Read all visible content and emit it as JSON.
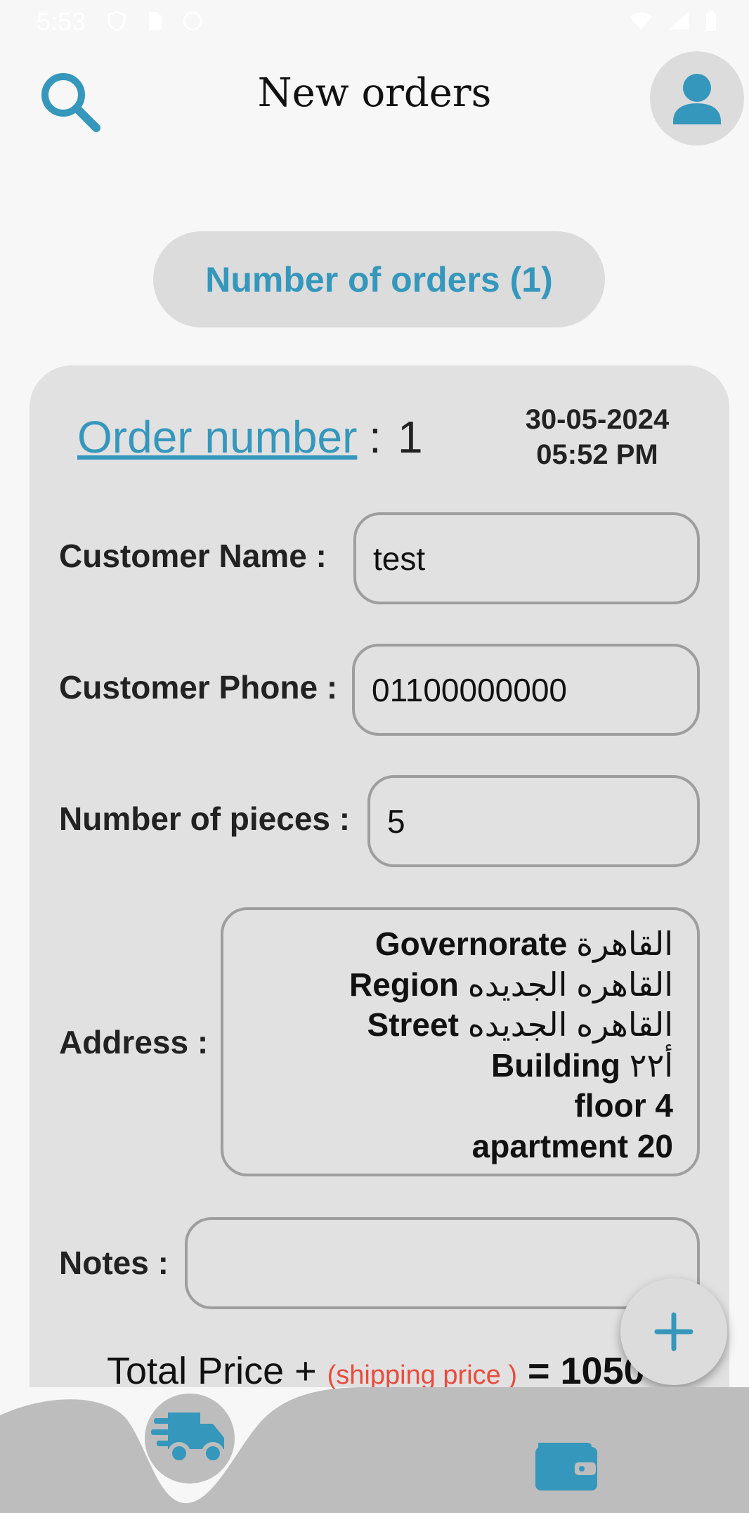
{
  "status_bar": {
    "time": "5:53"
  },
  "header": {
    "title": "New orders"
  },
  "orders_count": "Number of orders (1)",
  "order": {
    "number_label": "Order number",
    "separator": ":",
    "number": "1",
    "date": "30-05-2024",
    "time": "05:52 PM",
    "fields": {
      "customer_name": {
        "label": "Customer Name  :",
        "value": "test"
      },
      "customer_phone": {
        "label": "Customer Phone :",
        "value": "01100000000"
      },
      "pieces": {
        "label": "Number of pieces :",
        "value": "5"
      },
      "address": {
        "label": "Address :",
        "lines": [
          {
            "key": "Governorate",
            "value": "القاهرة"
          },
          {
            "key": "Region",
            "value": "القاهره الجديده"
          },
          {
            "key": "Street",
            "value": "القاهره الجديده"
          },
          {
            "key": "Building",
            "value": "أ٢٢"
          },
          {
            "key": "floor",
            "value": "4"
          },
          {
            "key": "apartment",
            "value": "20"
          }
        ]
      },
      "notes": {
        "label": "Notes :",
        "value": ""
      }
    },
    "total": {
      "prefix": "Total Price + ",
      "shipping": "(shipping price )",
      "suffix": " = 1050"
    }
  },
  "colors": {
    "accent": "#3597bb",
    "shipping": "#e94b3c",
    "card": "#e1e1e1",
    "nav": "#bdbdbd"
  },
  "icons": [
    "search-icon",
    "person-icon",
    "plus-icon",
    "truck-icon",
    "wallet-icon"
  ]
}
